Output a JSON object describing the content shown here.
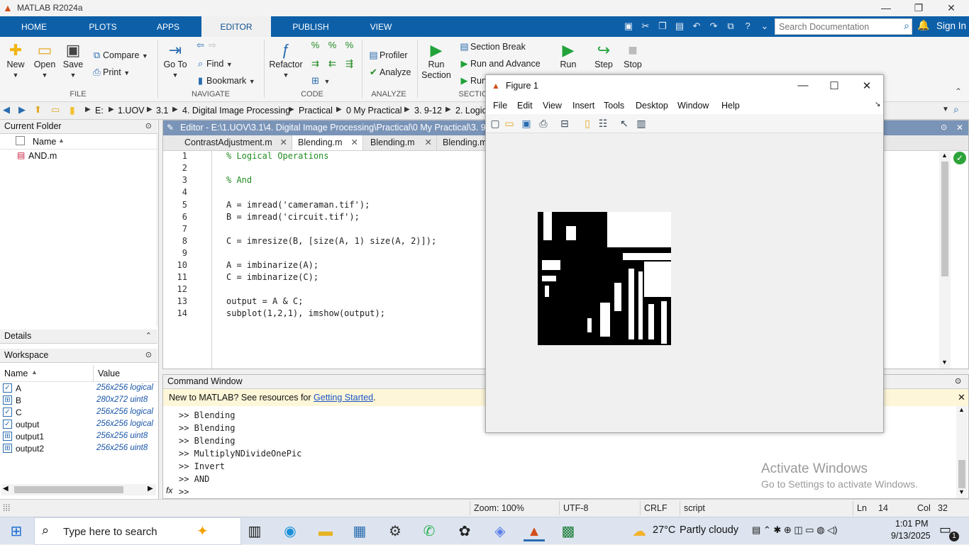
{
  "window": {
    "title": "MATLAB R2024a",
    "minimize": "—",
    "restore": "❐",
    "close": "✕"
  },
  "tabs": [
    {
      "label": "HOME"
    },
    {
      "label": "PLOTS"
    },
    {
      "label": "APPS"
    },
    {
      "label": "EDITOR"
    },
    {
      "label": "PUBLISH"
    },
    {
      "label": "VIEW"
    }
  ],
  "search": {
    "placeholder": "Search Documentation"
  },
  "signin": "Sign In",
  "ribbon": {
    "file": {
      "new": "New",
      "open": "Open",
      "save": "Save",
      "compare": "Compare",
      "print": "Print",
      "group": "FILE"
    },
    "navigate": {
      "goto": "Go To",
      "find": "Find",
      "bookmark": "Bookmark",
      "group": "NAVIGATE"
    },
    "code": {
      "refactor": "Refactor",
      "group": "CODE"
    },
    "analyze": {
      "profiler": "Profiler",
      "analyze": "Analyze",
      "group": "ANALYZE"
    },
    "section": {
      "run_section": "Run Section",
      "section_break": "Section Break",
      "run_and_advance": "Run and Advance",
      "run_and_time": "Run and Time",
      "group": "SECTION"
    },
    "run": {
      "run": "Run",
      "step": "Step",
      "stop": "Stop"
    }
  },
  "address": [
    "E:",
    "1.UOV",
    "3.1",
    "4. Digital Image Processing",
    "Practical",
    "0 My Practical",
    "3. 9-12",
    "2. Logic"
  ],
  "current_folder": {
    "title": "Current Folder",
    "col_name": "Name",
    "files": [
      "AND.m"
    ]
  },
  "details": {
    "title": "Details"
  },
  "workspace": {
    "title": "Workspace",
    "col_name": "Name",
    "col_value": "Value",
    "rows": [
      {
        "name": "A",
        "value": "256x256 logical",
        "logical": true
      },
      {
        "name": "B",
        "value": "280x272 uint8",
        "logical": false
      },
      {
        "name": "C",
        "value": "256x256 logical",
        "logical": true
      },
      {
        "name": "output",
        "value": "256x256 logical",
        "logical": true
      },
      {
        "name": "output1",
        "value": "256x256 uint8",
        "logical": false
      },
      {
        "name": "output2",
        "value": "256x256 uint8",
        "logical": false
      }
    ]
  },
  "editor": {
    "title": "Editor - E:\\1.UOV\\3.1\\4. Digital Image Processing\\Practical\\0 My Practical\\3. 9-12\\2. Logic",
    "tabs": [
      "ContrastAdjustment.m",
      "Blending.m",
      "Blending.m",
      "Blending.m"
    ],
    "lines": [
      {
        "n": "1",
        "text": "% Logical Operations"
      },
      {
        "n": "2",
        "text": ""
      },
      {
        "n": "3",
        "text": "% And"
      },
      {
        "n": "4",
        "text": ""
      },
      {
        "n": "5",
        "text": "A = imread('cameraman.tif');"
      },
      {
        "n": "6",
        "text": "B = imread('circuit.tif');"
      },
      {
        "n": "7",
        "text": ""
      },
      {
        "n": "8",
        "text": "C = imresize(B, [size(A, 1) size(A, 2)]);"
      },
      {
        "n": "9",
        "text": ""
      },
      {
        "n": "10",
        "text": "A = imbinarize(A);"
      },
      {
        "n": "11",
        "text": "C = imbinarize(C);"
      },
      {
        "n": "12",
        "text": ""
      },
      {
        "n": "13",
        "text": "output = A & C;"
      },
      {
        "n": "14",
        "text": "subplot(1,2,1), imshow(output);"
      }
    ]
  },
  "command_window": {
    "title": "Command Window",
    "notice_text": "New to MATLAB? See resources for ",
    "notice_link": "Getting Started",
    "notice_end": ".",
    "history": [
      ">> Blending",
      ">> Blending",
      ">> Blending",
      ">> MultiplyNDivideOnePic",
      ">> Invert",
      ">> AND"
    ],
    "prompt": ">>",
    "fx": "fx"
  },
  "watermark": {
    "line1": "Activate Windows",
    "line2": "Go to Settings to activate Windows."
  },
  "figure": {
    "title": "Figure 1",
    "menu": [
      "File",
      "Edit",
      "View",
      "Insert",
      "Tools",
      "Desktop",
      "Window",
      "Help"
    ]
  },
  "status": {
    "zoom": "Zoom: 100%",
    "encoding": "UTF-8",
    "eol": "CRLF",
    "type": "script",
    "ln_label": "Ln",
    "ln": "14",
    "col_label": "Col",
    "col": "32"
  },
  "taskbar": {
    "search_placeholder": "Type here to search",
    "weather_temp": "27°C",
    "weather_desc": "Partly cloudy",
    "time": "1:01 PM",
    "date": "9/13/2025",
    "notifications": "1"
  }
}
